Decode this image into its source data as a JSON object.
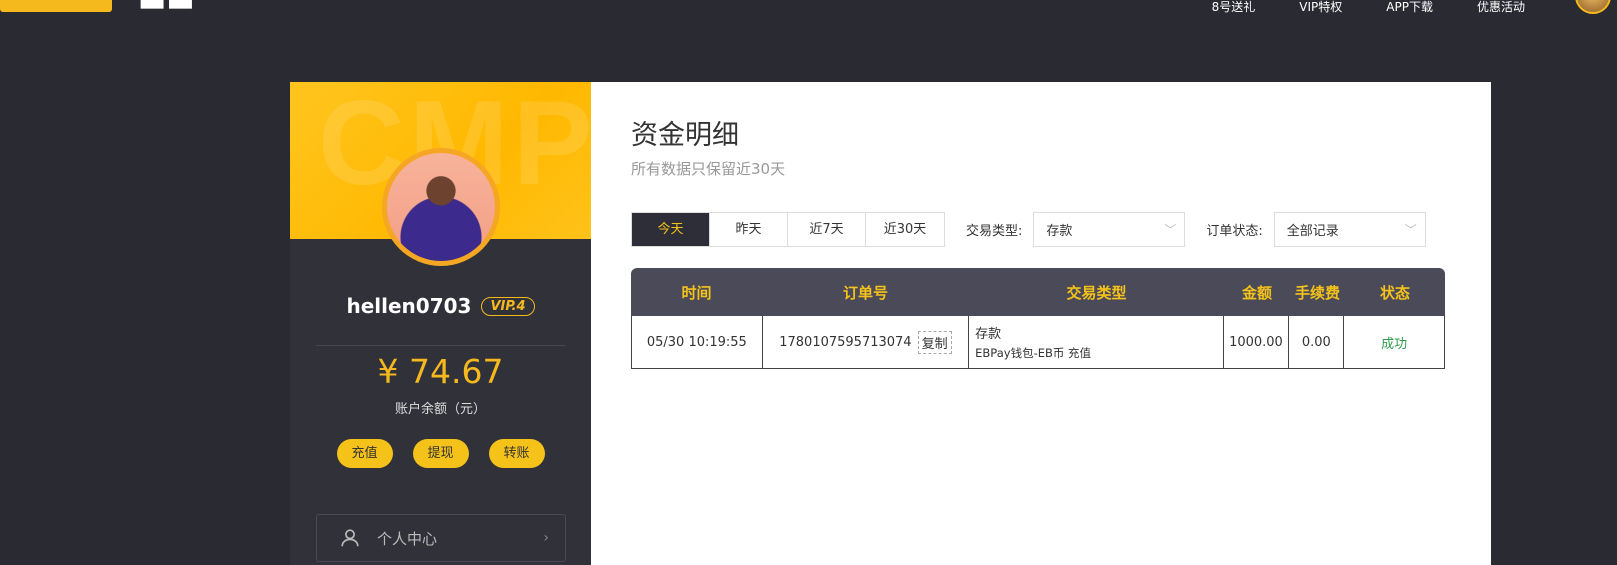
{
  "topnav": {
    "links": [
      "8号送礼",
      "VIP特权",
      "APP下载",
      "优惠活动"
    ]
  },
  "sidebar": {
    "banner_watermark": "CMP",
    "username": "hellen0703",
    "vip": "VIP.4",
    "balance": "¥ 74.67",
    "balance_label": "账户余额（元）",
    "actions": [
      "充值",
      "提现",
      "转账"
    ],
    "menu": {
      "personal_center": "个人中心"
    }
  },
  "content": {
    "title": "资金明细",
    "subtitle": "所有数据只保留近30天",
    "date_tabs": [
      "今天",
      "昨天",
      "近7天",
      "近30天"
    ],
    "active_tab": 0,
    "filters": {
      "type_label": "交易类型:",
      "type_value": "存款",
      "status_label": "订单状态:",
      "status_value": "全部记录"
    },
    "table": {
      "headers": [
        "时间",
        "订单号",
        "交易类型",
        "金额",
        "手续费",
        "状态"
      ],
      "rows": [
        {
          "time": "05/30 10:19:55",
          "order_no": "1780107595713074",
          "copy": "复制",
          "type": "存款",
          "type_detail": "EBPay钱包-EB币 充值",
          "amount": "1000.00",
          "fee": "0.00",
          "status": "成功"
        }
      ]
    }
  },
  "colors": {
    "accent": "#f5c21a",
    "background": "#2a2a33",
    "sidebar": "#31313a",
    "success": "#2e9c4a"
  }
}
